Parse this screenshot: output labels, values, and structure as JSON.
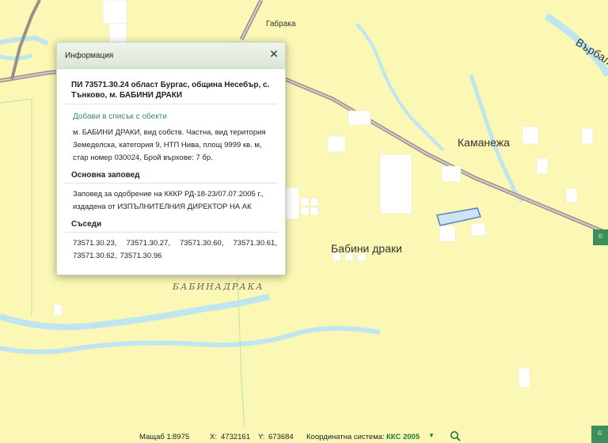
{
  "map": {
    "places": [
      {
        "id": "gabraka",
        "label": "Габрака"
      },
      {
        "id": "varbala",
        "label": "Върбала"
      },
      {
        "id": "kamanezha",
        "label": "Каманежа"
      },
      {
        "id": "babini-draki",
        "label": "Бабини драки"
      },
      {
        "id": "babinadraka",
        "label": "БАБИНАДРАКА"
      }
    ],
    "colors": {
      "land": "#fbf7b4",
      "water": "#bfe6ef",
      "road": "#9a8f8f",
      "parcel_highlight": "#4a86c9",
      "buildings": "#ffffff"
    }
  },
  "dialog": {
    "title": "Информация",
    "close_icon": "close-icon",
    "parcel_title": "ПИ 73571.30.24 област Бургас, община Несебър, с. Тънково, м. БАБИНИ ДРАКИ",
    "add_to_list": "Добави в списък с обекти",
    "description": "м. БАБИНИ ДРАКИ, вид собств. Частна, вид територия Земеделска, категория 9, НТП Нива, площ 9999 кв. м, стар номер 030024, Брой върхове: 7 бр.",
    "order_heading": "Основна заповед",
    "order_text": "Заповед за одобрение на КККР РД-18-23/07.07.2005 г., издадена от ИЗПЪЛНИТЕЛНИЯ ДИРЕКТОР НА АК",
    "neighbors_heading": "Съседи",
    "neighbors": [
      "73571.30.23,",
      "73571.30.27,",
      "73571.30.60,",
      "73571.30.61,",
      "73571.30.62,",
      "73571.30.96"
    ]
  },
  "statusbar": {
    "scale_label": "Мащаб 1:",
    "scale_value": "8975",
    "x_label": "X:",
    "x_value": "4732161",
    "y_label": "Y:",
    "y_value": "673684",
    "crs_label": "Координатна система:",
    "crs_value": "ККС 2005",
    "crs_caret": "▼",
    "search_icon": "search-icon",
    "badge_text": "©"
  }
}
